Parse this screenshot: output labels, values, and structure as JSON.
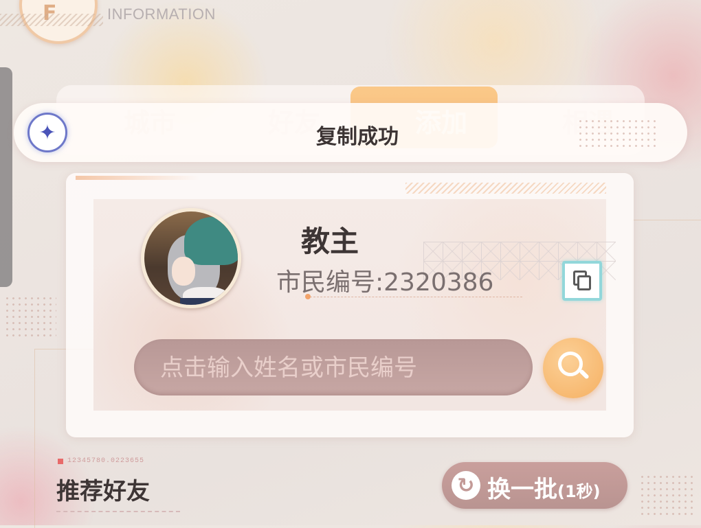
{
  "header": {
    "subtitle": "INFORMATION",
    "logo_glyph": "F"
  },
  "tabs": [
    {
      "label": "城市",
      "active": false
    },
    {
      "label": "好友",
      "active": false
    },
    {
      "label": "添加",
      "active": true
    },
    {
      "label": "相遇",
      "active": false
    }
  ],
  "toast": {
    "icon": "sparkle-icon",
    "message": "复制成功"
  },
  "profile": {
    "name": "教主",
    "citizen_id_label": "市民编号:2320386",
    "copy_icon": "copy-icon"
  },
  "search": {
    "placeholder": "点击输入姓名或市民编号",
    "value": "",
    "icon": "search-icon"
  },
  "recommend": {
    "code": "12345780.0223655",
    "title": "推荐好友",
    "refresh_label": "换一批",
    "refresh_cooldown": "(1秒)",
    "refresh_icon": "refresh-icon"
  },
  "colors": {
    "accent_orange": "#f7b96d",
    "toast_icon_blue": "#4a54b8",
    "copy_border": "#92d7da",
    "search_bg": "#c7a7a4"
  }
}
